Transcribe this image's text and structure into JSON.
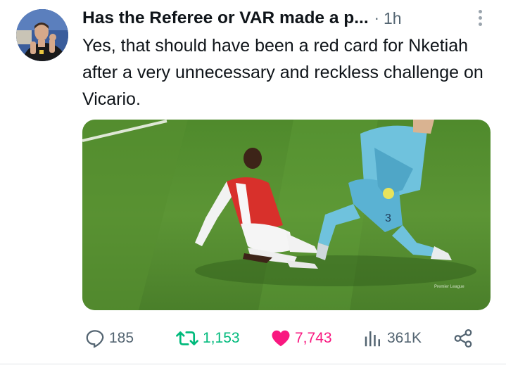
{
  "tweet": {
    "author_name": "Has the Referee or VAR made a p...",
    "separator": "·",
    "timestamp": "1h",
    "text": "Yes, that should have been a red card for Nketiah after a very unnecessary and reckless challenge on Vicario.",
    "media": {
      "watermark": "Premier League"
    }
  },
  "actions": {
    "replies": "185",
    "retweets": "1,153",
    "likes": "7,743",
    "views": "361K"
  },
  "icons": {
    "reply": "reply-icon",
    "retweet": "retweet-icon",
    "like": "heart-icon",
    "views": "views-icon",
    "share": "share-icon",
    "more": "more-icon"
  },
  "colors": {
    "retweet_active": "#00ba7c",
    "like_active": "#f91880",
    "secondary_text": "#536471",
    "primary_text": "#0f1419"
  }
}
